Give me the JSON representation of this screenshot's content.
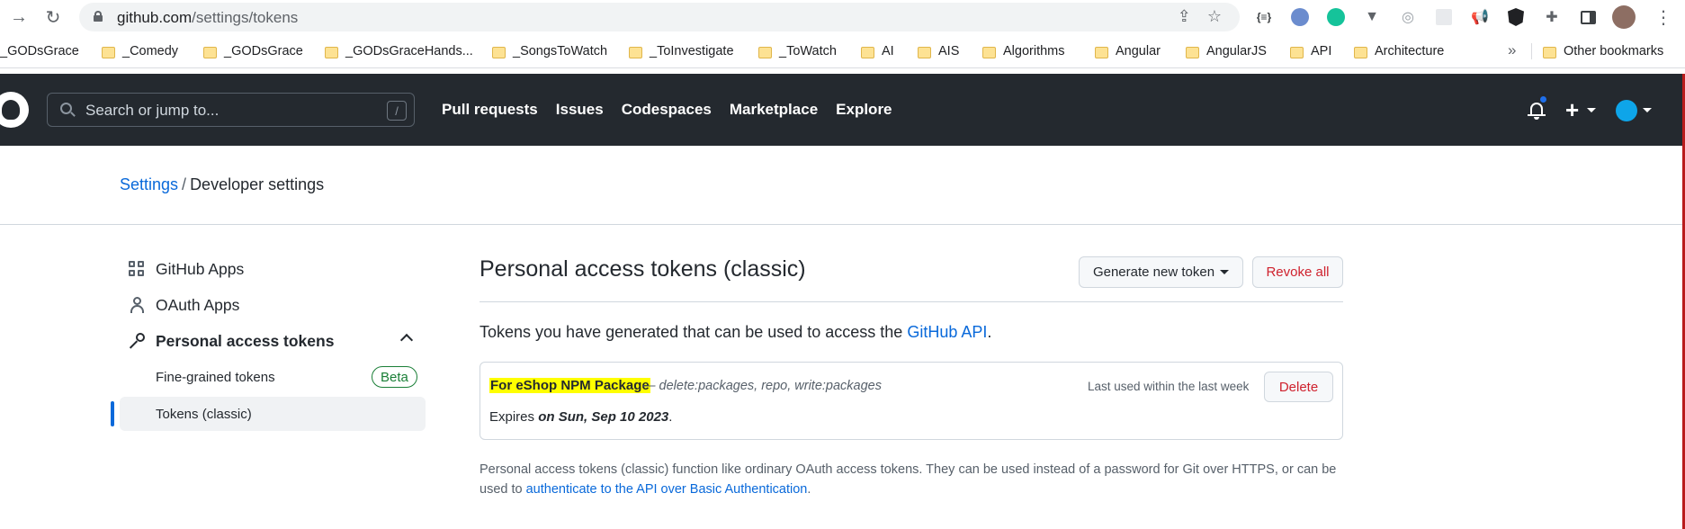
{
  "browser": {
    "url_host": "github.com",
    "url_path": "/settings/tokens",
    "bookmarks": [
      "_GODsGrace",
      "_Comedy",
      "_GODsGrace",
      "_GODsGraceHands...",
      "_SongsToWatch",
      "_ToInvestigate",
      "_ToWatch",
      "AI",
      "AIS",
      "Algorithms",
      "Angular",
      "AngularJS",
      "API",
      "Architecture"
    ],
    "more_bookmarks": "»",
    "other_bookmarks": "Other bookmarks"
  },
  "header": {
    "search_placeholder": "Search or jump to...",
    "search_shortcut": "/",
    "nav": [
      "Pull requests",
      "Issues",
      "Codespaces",
      "Marketplace",
      "Explore"
    ],
    "plus": "+"
  },
  "breadcrumb": {
    "settings": "Settings",
    "separator": "/",
    "current": "Developer settings"
  },
  "sidebar": {
    "items": [
      {
        "label": "GitHub Apps",
        "icon": "apps-icon"
      },
      {
        "label": "OAuth Apps",
        "icon": "person-icon"
      },
      {
        "label": "Personal access tokens",
        "icon": "key-icon"
      }
    ],
    "subitems": [
      {
        "label": "Fine-grained tokens",
        "badge": "Beta"
      },
      {
        "label": "Tokens (classic)"
      }
    ]
  },
  "main": {
    "title": "Personal access tokens (classic)",
    "generate_button": "Generate new token",
    "revoke_button": "Revoke all",
    "intro_text": "Tokens you have generated that can be used to access the",
    "intro_link": "GitHub API",
    "intro_end": ".",
    "token": {
      "name": "For eShop NPM Package",
      "scopes": "— delete:packages, repo, write:packages",
      "last_used": "Last used within the last week",
      "delete_button": "Delete",
      "expires_label": "Expires",
      "expires_date": "on Sun, Sep 10 2023",
      "expires_end": "."
    },
    "footnote_text": "Personal access tokens (classic) function like ordinary OAuth access tokens. They can be used instead of a password for Git over HTTPS, or can be used to",
    "footnote_link": "authenticate to the API over Basic Authentication",
    "footnote_end": "."
  },
  "colors": {
    "header_bg": "#24292f",
    "link": "#0969da",
    "danger": "#cf222e",
    "highlight": "#ffff00",
    "active_bar": "#0969da"
  }
}
